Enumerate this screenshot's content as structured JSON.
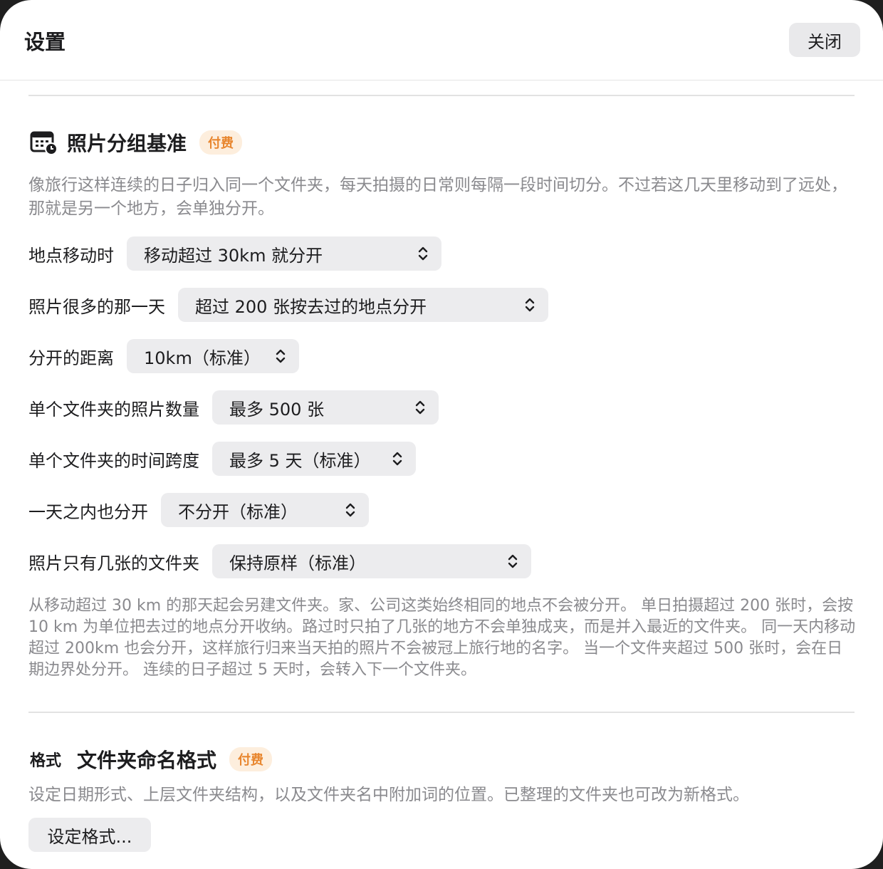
{
  "header": {
    "title": "设置",
    "close_label": "关闭"
  },
  "grouping": {
    "icon": "calendar-clock-icon",
    "title": "照片分组基准",
    "badge": "付费",
    "description": "像旅行这样连续的日子归入同一个文件夹，每天拍摄的日常则每隔一段时间切分。不过若这几天里移动到了远处，那就是另一个地方，会单独分开。",
    "rows": [
      {
        "label": "地点移动时",
        "value": "移动超过 30km 就分开"
      },
      {
        "label": "照片很多的那一天",
        "value": "超过 200 张按去过的地点分开"
      },
      {
        "label": "分开的距离",
        "value": "10km（标准）"
      },
      {
        "label": "单个文件夹的照片数量",
        "value": "最多 500 张"
      },
      {
        "label": "单个文件夹的时间跨度",
        "value": "最多 5 天（标准）"
      },
      {
        "label": "一天之内也分开",
        "value": "不分开（标准）"
      },
      {
        "label": "照片只有几张的文件夹",
        "value": "保持原样（标准）"
      }
    ],
    "note": "从移动超过 30 km 的那天起会另建文件夹。家、公司这类始终相同的地点不会被分开。 单日拍摄超过 200 张时，会按 10 km 为单位把去过的地点分开收纳。路过时只拍了几张的地方不会单独成夹，而是并入最近的文件夹。 同一天内移动超过 200km 也会分开，这样旅行归来当天拍的照片不会被冠上旅行地的名字。 当一个文件夹超过 500 张时，会在日期边界处分开。 连续的日子超过 5 天时，会转入下一个文件夹。"
  },
  "format": {
    "tag": "格式",
    "title": "文件夹命名格式",
    "badge": "付费",
    "description": "设定日期形式、上层文件夹结构，以及文件夹名中附加词的位置。已整理的文件夹也可改为新格式。",
    "button_label": "设定格式..."
  }
}
